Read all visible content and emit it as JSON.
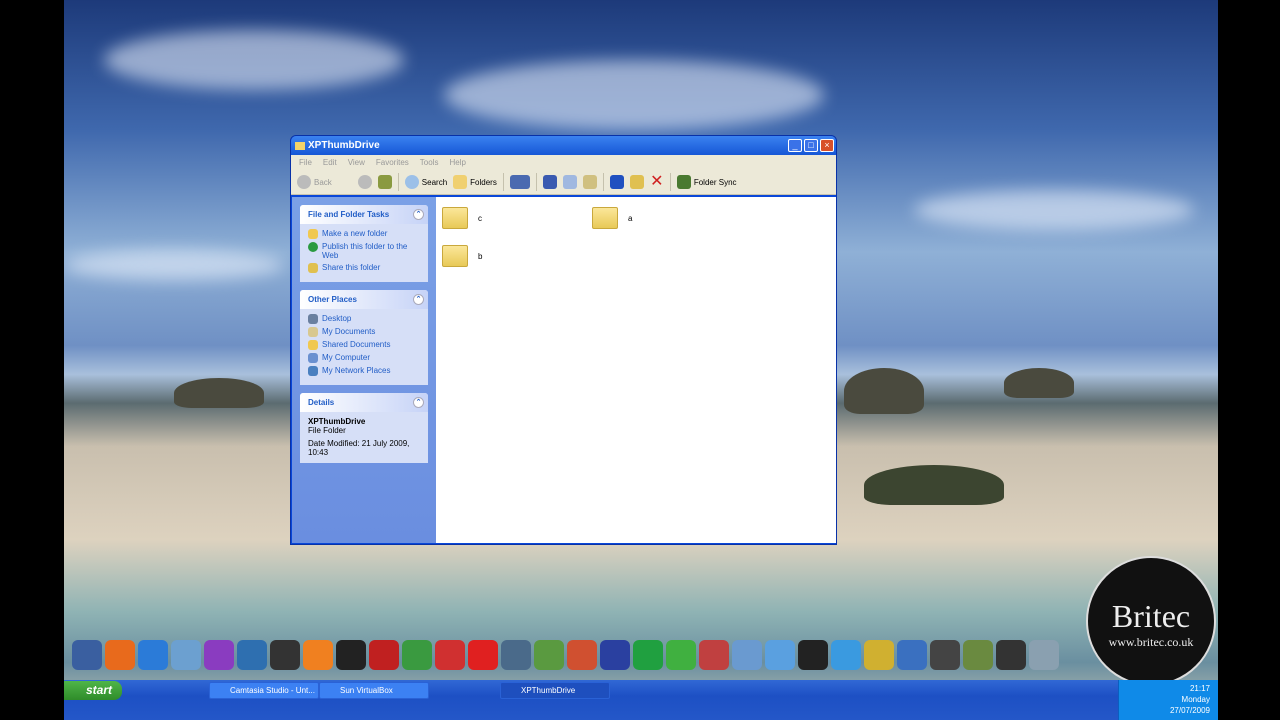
{
  "window": {
    "title": "XPThumbDrive",
    "menu": [
      "File",
      "Edit",
      "View",
      "Favorites",
      "Tools",
      "Help"
    ],
    "toolbar": {
      "back": "Back",
      "search": "Search",
      "folders": "Folders",
      "folder_sync": "Folder Sync"
    }
  },
  "tasks_panel": {
    "title": "File and Folder Tasks",
    "items": [
      "Make a new folder",
      "Publish this folder to the Web",
      "Share this folder"
    ]
  },
  "places_panel": {
    "title": "Other Places",
    "items": [
      "Desktop",
      "My Documents",
      "Shared Documents",
      "My Computer",
      "My Network Places"
    ]
  },
  "details_panel": {
    "title": "Details",
    "name": "XPThumbDrive",
    "type": "File Folder",
    "modified": "Date Modified: 21 July 2009, 10:43"
  },
  "folders": [
    "c",
    "a",
    "b"
  ],
  "taskbar": {
    "start": "start",
    "tasks": [
      "Camtasia Studio - Unt...",
      "Sun VirtualBox",
      "XPThumbDrive"
    ],
    "clock": {
      "time": "21:17",
      "day": "Monday",
      "date": "27/07/2009"
    }
  },
  "watermark": {
    "brand": "Britec",
    "url": "www.britec.co.uk"
  }
}
